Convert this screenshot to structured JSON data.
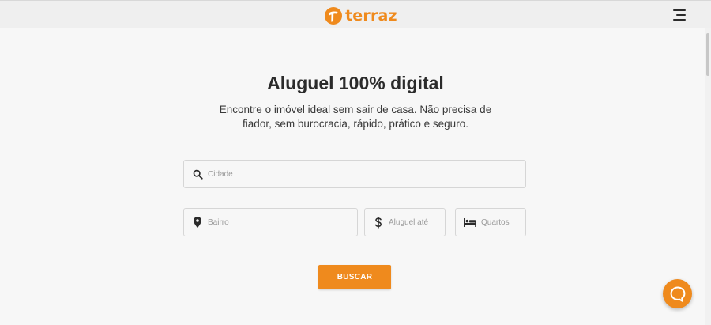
{
  "header": {
    "logo_text": "terraz",
    "brand_color": "#ef8a1d",
    "menu_icon": "hamburger-menu-icon"
  },
  "hero": {
    "title": "Aluguel 100% digital",
    "subtitle": "Encontre o imóvel ideal sem sair de casa. Não precisa de fiador, sem burocracia, rápido, prático e seguro."
  },
  "search": {
    "city": {
      "placeholder": "Cidade",
      "value": "",
      "icon": "search-icon"
    },
    "neighborhood": {
      "placeholder": "Bairro",
      "value": "",
      "icon": "map-pin-icon"
    },
    "rent": {
      "placeholder": "Aluguel até",
      "value": "",
      "icon": "dollar-icon"
    },
    "rooms": {
      "placeholder": "Quartos",
      "value": "",
      "icon": "bed-icon"
    },
    "submit_label": "BUSCAR"
  },
  "chat": {
    "icon": "chat-bubble-icon"
  }
}
